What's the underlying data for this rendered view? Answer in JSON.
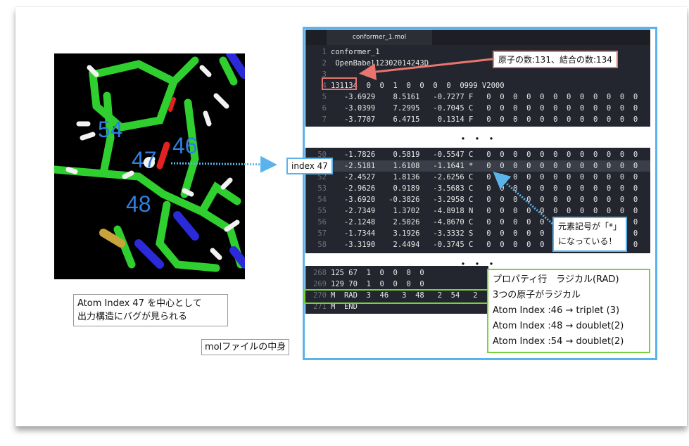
{
  "molecule_view": {
    "labels": [
      "54",
      "47",
      "46",
      "48"
    ]
  },
  "captions": {
    "atom_index_note": [
      "Atom Index 47 を中心として",
      "出力構造にバグが見られる"
    ],
    "mol_file_label": "molファイルの中身"
  },
  "editor": {
    "tab_title": "conformer_1.mol",
    "header_lines": [
      {
        "ln": "1",
        "text": "conformer_1"
      },
      {
        "ln": "2",
        "text": " OpenBabel12302014243D"
      },
      {
        "ln": "3",
        "text": ""
      },
      {
        "ln": "4",
        "text": "131134  0  0  1  0  0  0  0  0999 V2000"
      },
      {
        "ln": "5",
        "text": "   -3.6929    8.5161   -0.7277 F   0  0  0  0  0  0  0  0  0  0  0  0"
      },
      {
        "ln": "6",
        "text": "   -3.0399    7.2995   -0.7045 C   0  0  0  0  0  0  0  0  0  0  0  0"
      },
      {
        "ln": "7",
        "text": "   -3.7707    6.4715    0.1314 F   0  0  0  0  0  0  0  0  0  0  0  0"
      }
    ],
    "atom_lines": [
      {
        "ln": "50",
        "text": "   -1.7826    0.5819   -0.5547 C   0  0  0  0  0  0  0  0  0  0  0  0"
      },
      {
        "ln": "51",
        "text": "   -2.5181    1.6108   -1.1641 *   0  0  0  0  0  0  0  0  0  0  0  0"
      },
      {
        "ln": "52",
        "text": "   -2.4527    1.8136   -2.6256 C   0  0  0  0  0  0  0  0  0  0  0  0"
      },
      {
        "ln": "53",
        "text": "   -2.9626    0.9189   -3.5683 C   0  0  0  0  0  0  0  0  0  0  0  0"
      },
      {
        "ln": "54",
        "text": "   -3.6920   -0.3826   -3.2958 C   0  0  0  0  0  0  0  0  0  0  0  0"
      },
      {
        "ln": "55",
        "text": "   -2.7349    1.3702   -4.8918 N   0  0  0  0  0  0  0  0  0  0  0  0"
      },
      {
        "ln": "56",
        "text": "   -2.1248    2.5026   -4.8670 C   0  0  0  0  0  0  0  0  0  0  0  0"
      },
      {
        "ln": "57",
        "text": "   -1.7344    3.1926   -3.3332 S   0  0  0  0  0  0  0  0  0  0  0  0"
      },
      {
        "ln": "58",
        "text": "   -3.3190    2.4494   -0.3745 C   0  0  0  0  0  0  0  0  0  0  0  0"
      }
    ],
    "prop_lines": [
      {
        "ln": "268",
        "text": "125 67  1  0  0  0  0"
      },
      {
        "ln": "269",
        "text": "129 70  1  0  0  0  0"
      },
      {
        "ln": "270",
        "text": "M  RAD  3  46   3  48   2  54   2"
      },
      {
        "ln": "271",
        "text": "M  END"
      }
    ],
    "ellipsis": "・・・"
  },
  "callouts": {
    "counts": "原子の数:131、結合の数:134",
    "index47": "index 47",
    "element_symbol": [
      "元素記号が「*」",
      "になっている！"
    ],
    "property_row": [
      "プロパティ行　ラジカル(RAD)",
      "3つの原子がラジカル",
      "Atom Index :46 → triplet (3)",
      "Atom Index :48 → doublet(2)",
      "Atom Index :54 → doublet(2)"
    ]
  },
  "colors": {
    "accent_blue": "#5bb3ec",
    "accent_red": "#e8756e",
    "accent_green": "#7ad13f",
    "label_blue": "#2f7fe0"
  }
}
